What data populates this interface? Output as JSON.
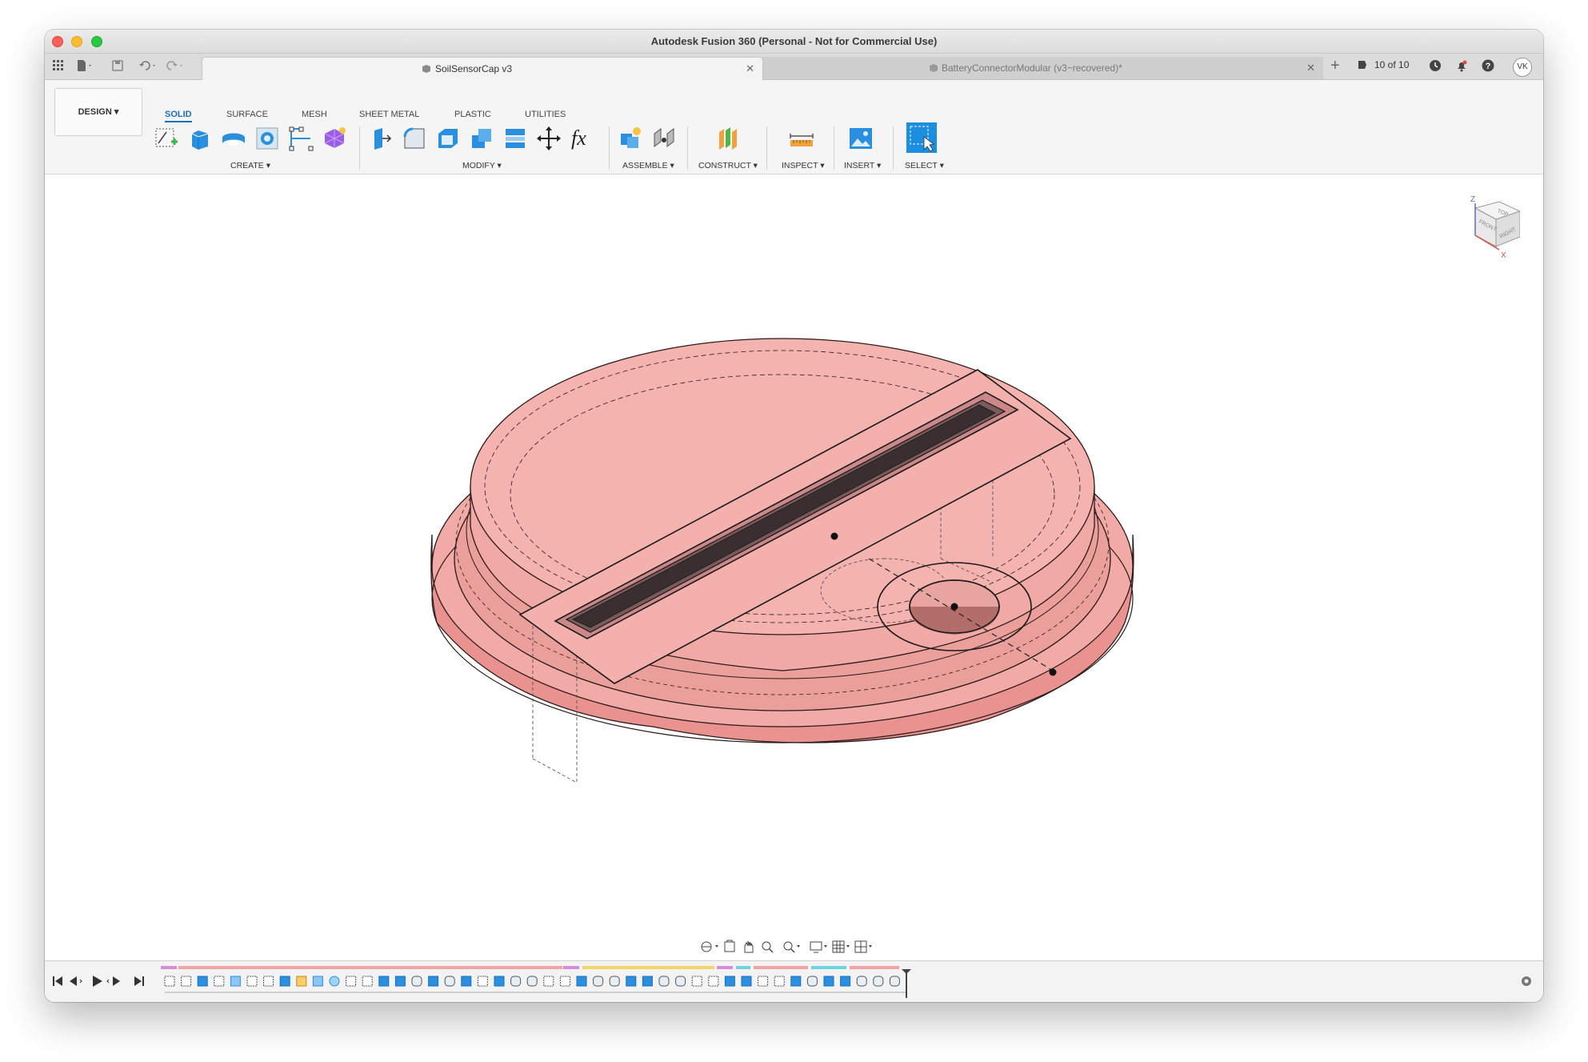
{
  "window": {
    "title": "Autodesk Fusion 360 (Personal - Not for Commercial Use)"
  },
  "tabs": [
    {
      "label": "SoilSensorCap v3",
      "active": true
    },
    {
      "label": "BatteryConnectorModular (v3~recovered)*",
      "active": false
    }
  ],
  "tabbar_right": {
    "job_status": "10 of 10",
    "user_initials": "VK"
  },
  "workspace": {
    "label": "DESIGN ▾"
  },
  "mode_tabs": [
    "SOLID",
    "SURFACE",
    "MESH",
    "SHEET METAL",
    "PLASTIC",
    "UTILITIES"
  ],
  "tool_groups": [
    "CREATE ▾",
    "MODIFY ▾",
    "ASSEMBLE ▾",
    "CONSTRUCT ▾",
    "INSPECT ▾",
    "INSERT ▾",
    "SELECT ▾"
  ],
  "viewcube": {
    "faces": [
      "TOP",
      "FRONT",
      "RIGHT"
    ],
    "axes": [
      "Z",
      "X"
    ]
  },
  "colors": {
    "body": "#f0a8a4",
    "accent": "#1b6ec2",
    "timeline_pink": "#f4a3a3",
    "timeline_purple": "#d98ad8",
    "timeline_yellow": "#f5d36b",
    "timeline_cyan": "#6fd3de"
  },
  "icons": {
    "grid": "app-grid-icon",
    "file": "file-icon",
    "save": "save-icon",
    "undo": "undo-icon",
    "redo": "redo-icon",
    "new_tab": "plus-icon",
    "clock": "clock-icon",
    "bell": "bell-icon",
    "help": "help-icon",
    "settings": "gear-icon"
  }
}
